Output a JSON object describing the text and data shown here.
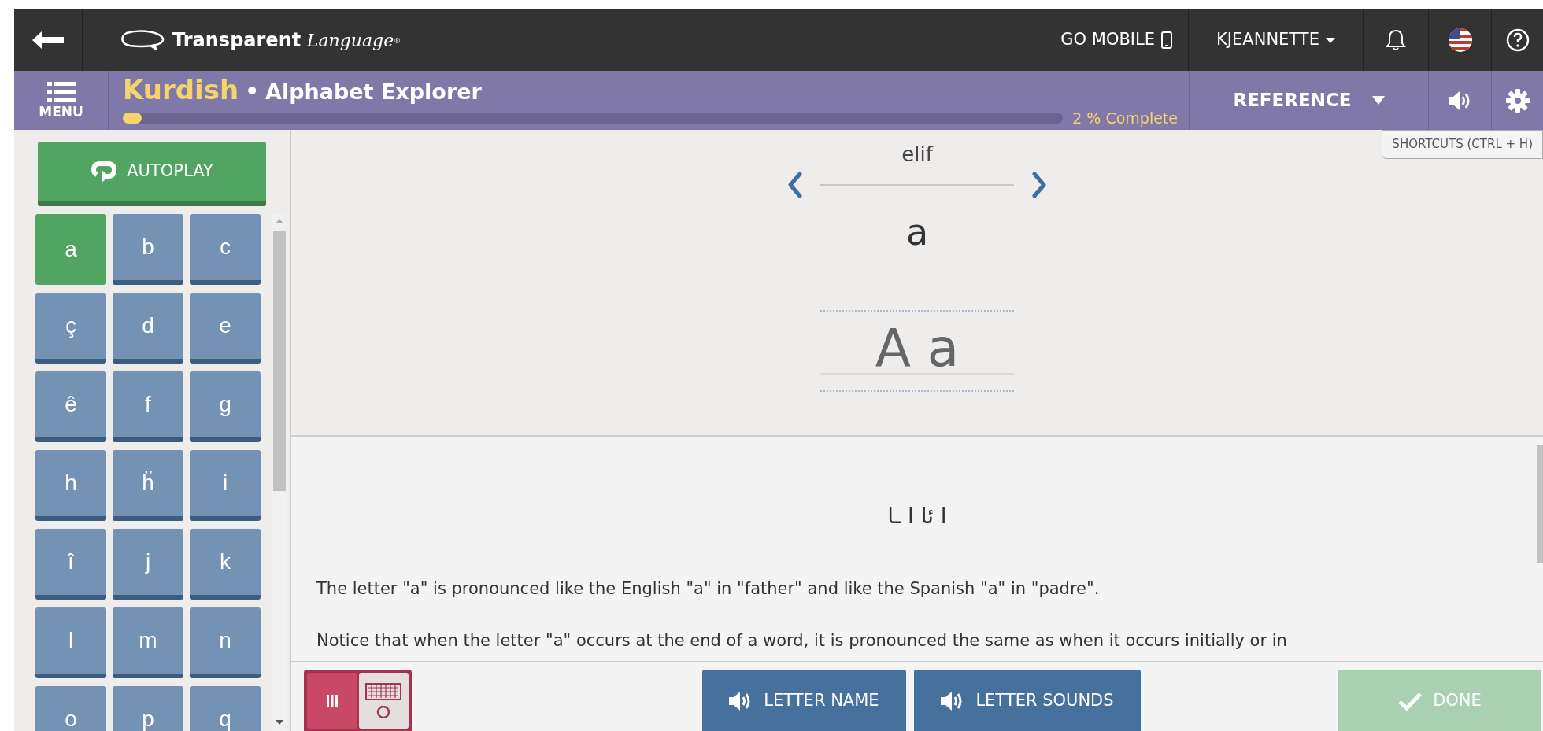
{
  "top_bar": {
    "logo_bold": "Transparent",
    "logo_italic": "Language",
    "logo_mark": "®",
    "go_mobile": "GO MOBILE",
    "user": "KJEANNETTE"
  },
  "course_bar": {
    "menu_label": "MENU",
    "language": "Kurdish",
    "separator": "•",
    "activity": "Alphabet Explorer",
    "progress": {
      "level": 0.02,
      "label": "2 % Complete"
    },
    "reference": "REFERENCE"
  },
  "tooltip": "SHORTCUTS (CTRL + H)",
  "sidebar": {
    "autoplay": "AUTOPLAY",
    "letters": [
      {
        "label": "a",
        "selected": true
      },
      {
        "label": "b",
        "selected": false
      },
      {
        "label": "c",
        "selected": false
      },
      {
        "label": "ç",
        "selected": false
      },
      {
        "label": "d",
        "selected": false
      },
      {
        "label": "e",
        "selected": false
      },
      {
        "label": "ê",
        "selected": false
      },
      {
        "label": "f",
        "selected": false
      },
      {
        "label": "g",
        "selected": false
      },
      {
        "label": "h",
        "selected": false
      },
      {
        "label": "ḧ",
        "selected": false
      },
      {
        "label": "i",
        "selected": false
      },
      {
        "label": "î",
        "selected": false
      },
      {
        "label": "j",
        "selected": false
      },
      {
        "label": "k",
        "selected": false
      },
      {
        "label": "l",
        "selected": false
      },
      {
        "label": "m",
        "selected": false
      },
      {
        "label": "n",
        "selected": false
      },
      {
        "label": "o",
        "selected": false
      },
      {
        "label": "p",
        "selected": false
      },
      {
        "label": "q",
        "selected": false
      }
    ]
  },
  "letter_card": {
    "name": "elif",
    "letter": "a",
    "pair": "A a"
  },
  "explanation": {
    "arabic_forms": "ا ئا ا ـا",
    "paragraphs": [
      "The letter \"a\" is pronounced like the English \"a\" in \"father\" and like the Spanish \"a\" in \"padre\".",
      "Notice that when the letter \"a\" occurs at the end of a word, it is pronounced the same as when it occurs initially or in"
    ]
  },
  "bottom_bar": {
    "input_modes": [
      {
        "kind": "bars",
        "selected": true
      },
      {
        "kind": "keyboard",
        "selected": false
      }
    ],
    "audio_buttons": [
      {
        "label": "LETTER NAME"
      },
      {
        "label": "LETTER SOUNDS"
      }
    ],
    "done": {
      "label": "DONE",
      "disabled": true
    }
  }
}
